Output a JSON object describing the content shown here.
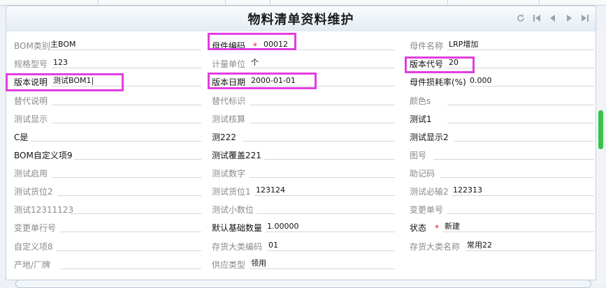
{
  "title": "物料清单资料维护",
  "nav_icons": [
    "refresh-icon",
    "first-record-icon",
    "previous-record-icon",
    "next-record-icon",
    "last-record-icon"
  ],
  "colors": {
    "highlight": "#e23ee0",
    "required": "#e02020",
    "scroll_thumb": "#37c34d"
  },
  "fields": {
    "bom_type": {
      "label": "BOM类别",
      "value": "主BOM"
    },
    "parent_code": {
      "label": "母件编码",
      "value": "00012",
      "required": "*"
    },
    "parent_name": {
      "label": "母件名称",
      "value": "LRP增加"
    },
    "spec_model": {
      "label": "规格型号",
      "value": "123"
    },
    "unit": {
      "label": "计量单位",
      "value": "个"
    },
    "version_code": {
      "label": "版本代号",
      "value": "20"
    },
    "version_desc": {
      "label": "版本说明",
      "value": "测试BOM1|"
    },
    "version_date": {
      "label": "版本日期",
      "value": "2000-01-01"
    },
    "parent_loss": {
      "label": "母件损耗率(%)",
      "value": "0.000"
    },
    "alt_desc": {
      "label": "替代说明",
      "value": ""
    },
    "alt_flag": {
      "label": "替代标识",
      "value": ""
    },
    "color": {
      "label": "颜色s",
      "value": ""
    },
    "test_display": {
      "label": "测试显示",
      "value": ""
    },
    "test_check": {
      "label": "测试核算",
      "value": ""
    },
    "test1": {
      "label": "测试1",
      "value": ""
    },
    "c_yes": {
      "label": "C是",
      "value": ""
    },
    "test222": {
      "label": "测222",
      "value": ""
    },
    "test_display2": {
      "label": "测试显示2",
      "value": ""
    },
    "bom_custom9": {
      "label": "BOM自定义项9",
      "value": ""
    },
    "test_cover221": {
      "label": "测试覆盖221",
      "value": ""
    },
    "drawing_no": {
      "label": "图号",
      "value": ""
    },
    "test_enable": {
      "label": "测试启用",
      "value": ""
    },
    "test_number": {
      "label": "测试数字",
      "value": ""
    },
    "mnemonic": {
      "label": "助记码",
      "value": ""
    },
    "test_slot2": {
      "label": "测试货位2",
      "value": ""
    },
    "test_slot1": {
      "label": "测试货位1",
      "value": "123124"
    },
    "test_required2": {
      "label": "测试必输2",
      "value": "122313"
    },
    "test12311123": {
      "label": "测试12311123",
      "value": ""
    },
    "test_decimal": {
      "label": "测试小数位",
      "value": ""
    },
    "change_no": {
      "label": "变更单号",
      "value": ""
    },
    "change_line": {
      "label": "变更单行号",
      "value": ""
    },
    "default_base_qty": {
      "label": "默认基础数量",
      "value": "1.00000"
    },
    "status": {
      "label": "状态",
      "value": "新建",
      "required": "*"
    },
    "custom8": {
      "label": "自定义项8",
      "value": ""
    },
    "inv_class_code": {
      "label": "存货大类编码",
      "value": "01"
    },
    "inv_class_name": {
      "label": "存货大类名称",
      "value": "常用22"
    },
    "origin_brand": {
      "label": "产地/厂牌",
      "value": ""
    },
    "supply_type": {
      "label": "供应类型",
      "value": "领用"
    }
  }
}
